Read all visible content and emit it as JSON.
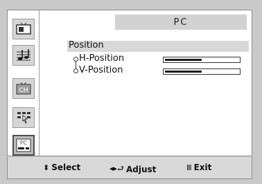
{
  "header": {
    "title": "PC"
  },
  "sidebar": {
    "items": [
      {
        "icon": "picture-icon"
      },
      {
        "icon": "sound-icon"
      },
      {
        "icon": "channel-icon",
        "label": "CH"
      },
      {
        "icon": "setup-icon"
      },
      {
        "icon": "pc-icon",
        "label": "PC"
      }
    ]
  },
  "section": {
    "label": "Position"
  },
  "rows": [
    {
      "label": "H-Position",
      "value": 0.5
    },
    {
      "label": "V-Position",
      "value": 0.5
    }
  ],
  "footer": {
    "select": {
      "glyph": "⬍",
      "label": "Select"
    },
    "adjust": {
      "glyph": "◂▸⮐",
      "label": "Adjust"
    },
    "exit": {
      "glyph": "Ⅲ",
      "label": "Exit"
    }
  },
  "colors": {
    "background": "#c9c9c9",
    "panel": "#ffffff",
    "bar": "#d8d8d8",
    "accent": "#1a1a1a"
  }
}
